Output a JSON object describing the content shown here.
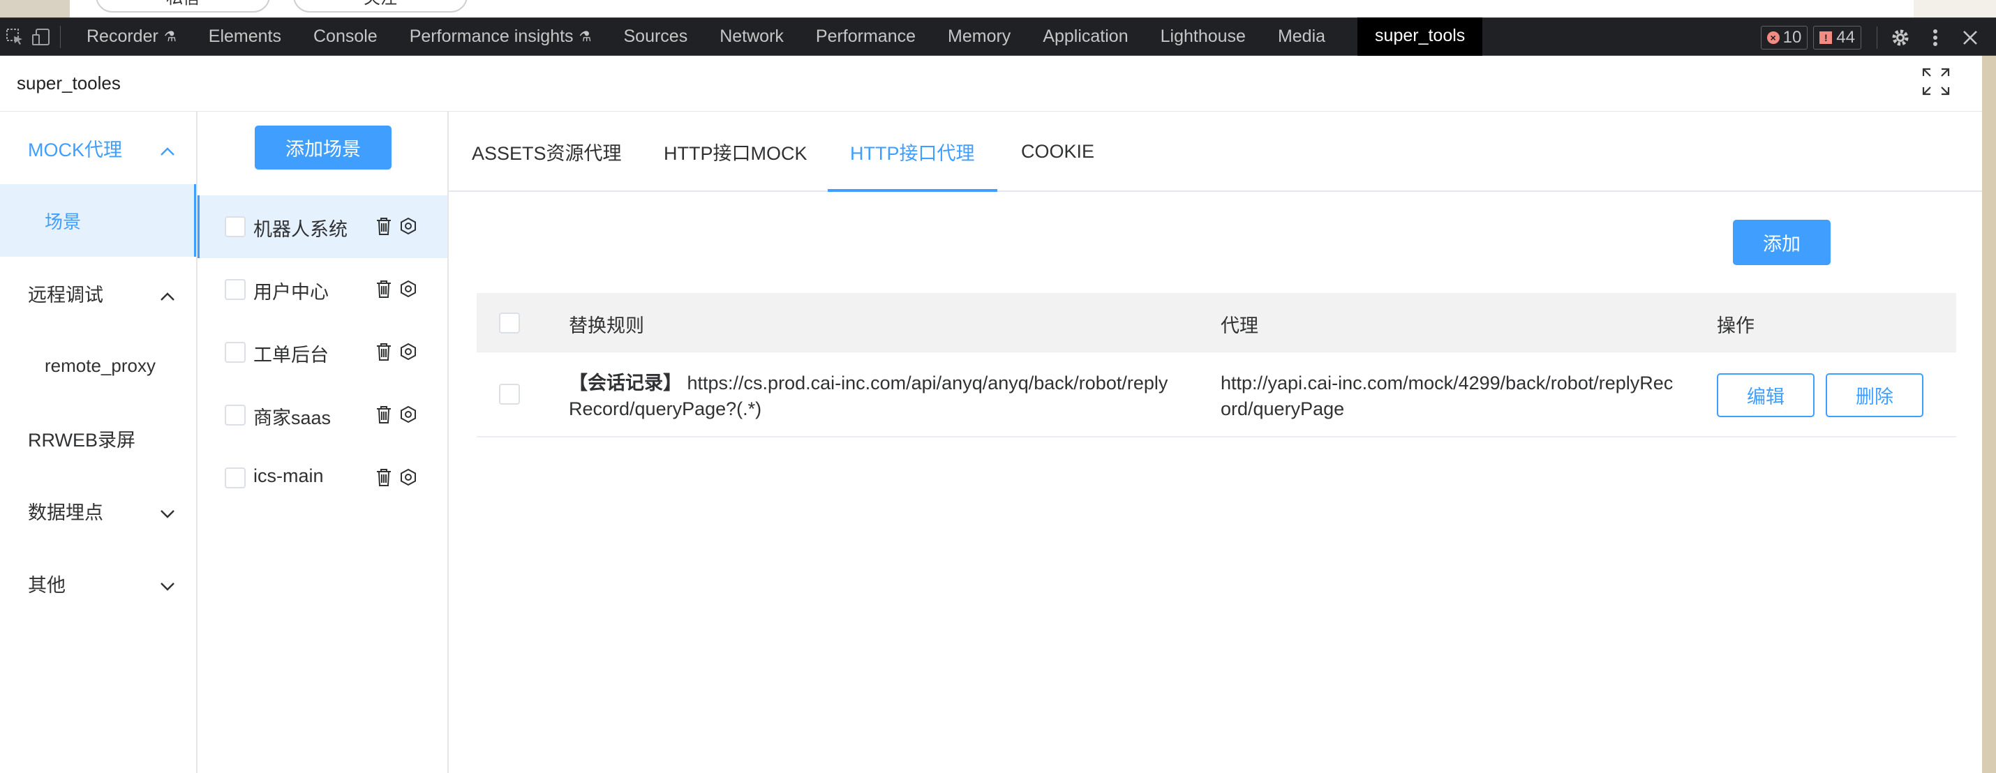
{
  "background_page": {
    "pills": [
      "私信",
      "关注"
    ]
  },
  "devtools": {
    "tabs": [
      "Recorder",
      "Elements",
      "Console",
      "Performance insights",
      "Sources",
      "Network",
      "Performance",
      "Memory",
      "Application",
      "Lighthouse",
      "Media"
    ],
    "active_tab": "super_tools",
    "errors": "10",
    "issues": "44"
  },
  "panel": {
    "title": "super_tooles"
  },
  "sidebar": {
    "items": [
      {
        "label": "MOCK代理",
        "expanded": true
      },
      {
        "label": "场景",
        "active": true
      },
      {
        "label": "远程调试",
        "expanded": true
      },
      {
        "label": "remote_proxy"
      },
      {
        "label": "RRWEB录屏"
      },
      {
        "label": "数据埋点",
        "expanded": false
      },
      {
        "label": "其他",
        "expanded": false
      }
    ]
  },
  "scenes": {
    "add_label": "添加场景",
    "items": [
      "机器人系统",
      "用户中心",
      "工单后台",
      "商家saas",
      "ics-main"
    ]
  },
  "main": {
    "tabs": [
      "ASSETS资源代理",
      "HTTP接口MOCK",
      "HTTP接口代理",
      "COOKIE"
    ],
    "active_tab": "HTTP接口代理",
    "add_label": "添加",
    "table": {
      "headers": [
        "替换规则",
        "代理",
        "操作"
      ],
      "rows": [
        {
          "rule_tag": "【会话记录】",
          "rule": "https://cs.prod.cai-inc.com/api/anyq/anyq/back/robot/replyRecord/queryPage?(.*)",
          "proxy": "http://yapi.cai-inc.com/mock/4299/back/robot/replyRecord/queryPage",
          "edit_label": "编辑",
          "delete_label": "删除"
        }
      ]
    }
  },
  "colors": {
    "primary": "#409eff",
    "devtools_bg": "#202124",
    "active_bg": "#e6f1fe"
  }
}
